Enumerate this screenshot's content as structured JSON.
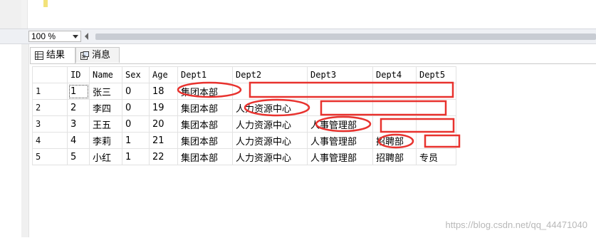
{
  "zoom": {
    "value": "100 %"
  },
  "tabs": [
    {
      "label": "结果",
      "icon": "grid-icon"
    },
    {
      "label": "消息",
      "icon": "message-icon"
    }
  ],
  "grid": {
    "columns": [
      "ID",
      "Name",
      "Sex",
      "Age",
      "Dept1",
      "Dept2",
      "Dept3",
      "Dept4",
      "Dept5"
    ],
    "rows": [
      {
        "num": "1",
        "cells": [
          "1",
          "张三",
          "0",
          "18",
          "集团本部",
          "",
          "",
          "",
          ""
        ]
      },
      {
        "num": "2",
        "cells": [
          "2",
          "李四",
          "0",
          "19",
          "集团本部",
          "人力资源中心",
          "",
          "",
          ""
        ]
      },
      {
        "num": "3",
        "cells": [
          "3",
          "王五",
          "0",
          "20",
          "集团本部",
          "人力资源中心",
          "人事管理部",
          "",
          ""
        ]
      },
      {
        "num": "4",
        "cells": [
          "4",
          "李莉",
          "1",
          "21",
          "集团本部",
          "人力资源中心",
          "人事管理部",
          "招聘部",
          ""
        ]
      },
      {
        "num": "5",
        "cells": [
          "5",
          "小红",
          "1",
          "22",
          "集团本部",
          "人力资源中心",
          "人事管理部",
          "招聘部",
          "专员"
        ]
      }
    ]
  },
  "annotation_color": "#e8322e",
  "watermark": "https://blog.csdn.net/qq_44471040"
}
